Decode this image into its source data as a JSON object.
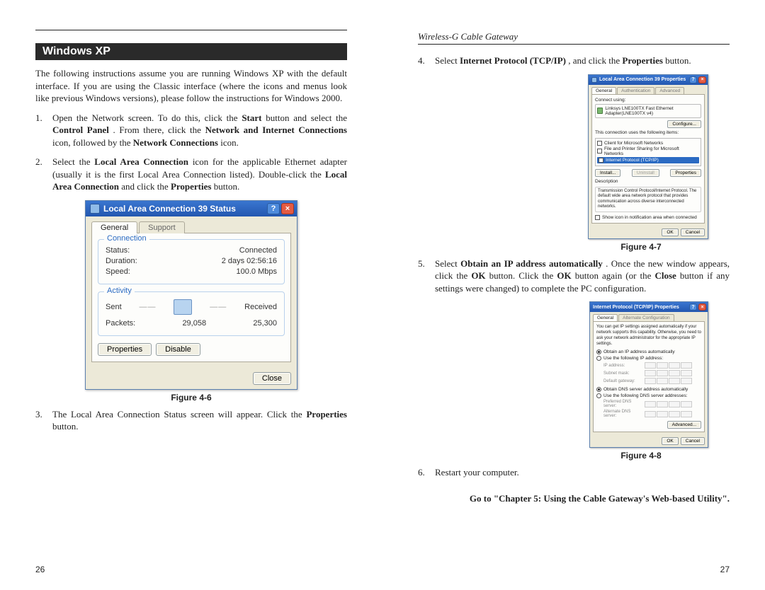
{
  "header_right": "Wireless-G Cable Gateway",
  "section_bar": "Windows XP",
  "intro": "The following instructions assume you are running Windows XP with the default interface. If you are using the Classic interface (where the icons and menus look like previous Windows versions), please follow the instructions for Windows 2000.",
  "steps_left": {
    "s1_pre": "Open the Network screen. To do this, click the ",
    "s1_b1": "Start",
    "s1_mid1": " button and select the ",
    "s1_b2": "Control Panel",
    "s1_mid2": ". From there, click the ",
    "s1_b3": "Network and Internet Connections",
    "s1_mid3": " icon, followed by the ",
    "s1_b4": "Network Connections",
    "s1_post": " icon.",
    "s2_pre": "Select the ",
    "s2_b1": "Local Area Connection",
    "s2_mid1": " icon for the applicable Ethernet adapter (usually it is the first Local Area Connection listed). Double-click the ",
    "s2_b2": "Local Area Connection",
    "s2_mid2": " and click the ",
    "s2_b3": "Properties",
    "s2_post": " button.",
    "s3_pre": "The Local Area Connection Status screen will appear. Click the ",
    "s3_b1": "Properties",
    "s3_post": " button."
  },
  "steps_right": {
    "s4_pre": "Select ",
    "s4_b1": "Internet Protocol (TCP/IP)",
    "s4_mid": ", and click the ",
    "s4_b2": "Properties",
    "s4_post": " button.",
    "s5_pre": "Select ",
    "s5_b1": "Obtain an IP address automatically",
    "s5_mid1": ". Once the new window appears, click the ",
    "s5_b2": "OK",
    "s5_mid2": " button. Click the ",
    "s5_b3": "OK",
    "s5_mid3": " button again (or the ",
    "s5_b4": "Close",
    "s5_post": " button if any settings were changed) to complete the PC configuration.",
    "s6": "Restart your computer."
  },
  "fig46": {
    "title": "Local Area Connection 39 Status",
    "tab_general": "General",
    "tab_support": "Support",
    "grp_conn": "Connection",
    "status_k": "Status:",
    "status_v": "Connected",
    "duration_k": "Duration:",
    "duration_v": "2 days 02:56:16",
    "speed_k": "Speed:",
    "speed_v": "100.0 Mbps",
    "grp_act": "Activity",
    "sent": "Sent",
    "received": "Received",
    "packets_k": "Packets:",
    "packets_sent": "29,058",
    "packets_recv": "25,300",
    "btn_props": "Properties",
    "btn_disable": "Disable",
    "btn_close": "Close",
    "caption": "Figure 4-6"
  },
  "fig47": {
    "title": "Local Area Connection 39 Properties",
    "tab_general": "General",
    "tab_auth": "Authentication",
    "tab_adv": "Advanced",
    "connect_using": "Connect using:",
    "adapter": "Linksys LNE100TX Fast Ethernet Adapter(LNE100TX v4)",
    "btn_configure": "Configure...",
    "uses_items": "This connection uses the following items:",
    "item1": "Client for Microsoft Networks",
    "item2": "File and Printer Sharing for Microsoft Networks",
    "item3": "Internet Protocol (TCP/IP)",
    "btn_install": "Install...",
    "btn_uninstall": "Uninstall",
    "btn_props": "Properties",
    "desc_lbl": "Description",
    "desc": "Transmission Control Protocol/Internet Protocol. The default wide area network protocol that provides communication across diverse interconnected networks.",
    "show_icon": "Show icon in notification area when connected",
    "btn_ok": "OK",
    "btn_cancel": "Cancel",
    "caption": "Figure 4-7"
  },
  "fig48": {
    "title": "Internet Protocol (TCP/IP) Properties",
    "tab_general": "General",
    "tab_alt": "Alternate Configuration",
    "info": "You can get IP settings assigned automatically if your network supports this capability. Otherwise, you need to ask your network administrator for the appropriate IP settings.",
    "r_obtain_ip": "Obtain an IP address automatically",
    "r_use_ip": "Use the following IP address:",
    "ip_k": "IP address:",
    "mask_k": "Subnet mask:",
    "gw_k": "Default gateway:",
    "r_obtain_dns": "Obtain DNS server address automatically",
    "r_use_dns": "Use the following DNS server addresses:",
    "dns1_k": "Preferred DNS server:",
    "dns2_k": "Alternate DNS server:",
    "btn_adv": "Advanced...",
    "btn_ok": "OK",
    "btn_cancel": "Cancel",
    "caption": "Figure 4-8"
  },
  "go_line": "Go to \"Chapter 5: Using the Cable Gateway's Web-based Utility\".",
  "page_left": "26",
  "page_right": "27"
}
